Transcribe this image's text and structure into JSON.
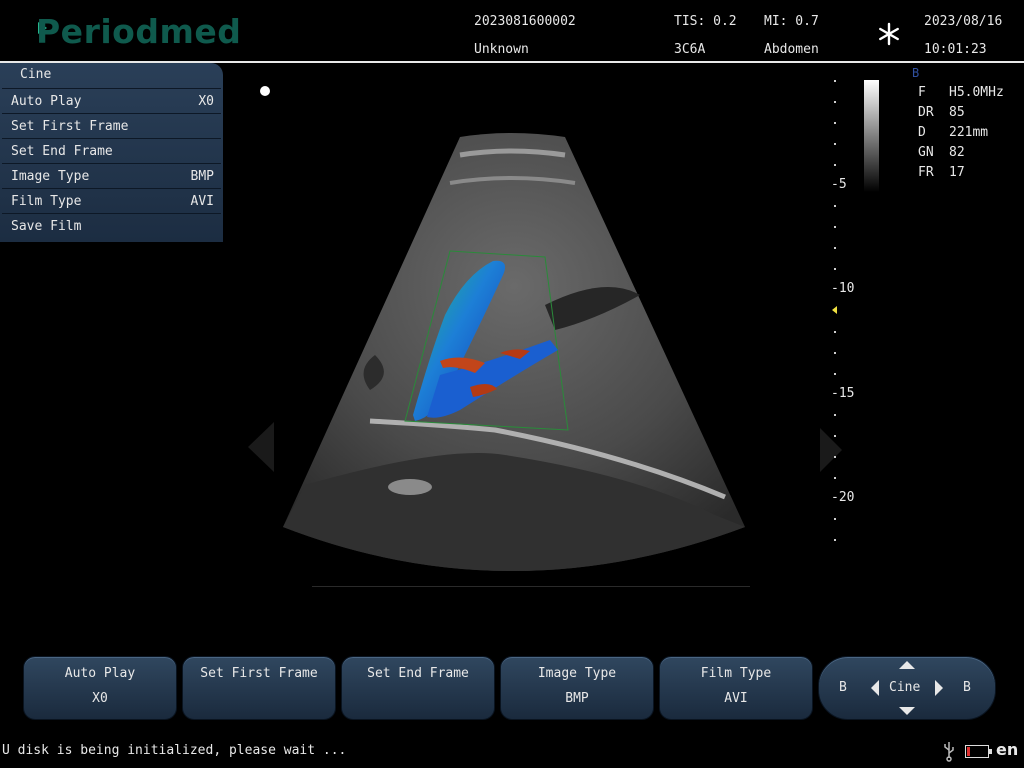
{
  "header": {
    "logo": "Periodmed",
    "patient_id": "2023081600002",
    "patient_name": "Unknown",
    "tis": "TIS: 0.2",
    "probe": "3C6A",
    "mi": "MI: 0.7",
    "exam": "Abdomen",
    "date": "2023/08/16",
    "time": "10:01:23"
  },
  "cine_menu": {
    "title": "Cine",
    "items": [
      {
        "label": "Auto Play",
        "value": "X0"
      },
      {
        "label": "Set First Frame",
        "value": ""
      },
      {
        "label": "Set End Frame",
        "value": ""
      },
      {
        "label": "Image Type",
        "value": "BMP"
      },
      {
        "label": "Film Type",
        "value": "AVI"
      },
      {
        "label": "Save Film",
        "value": ""
      }
    ]
  },
  "params": {
    "mode": "B",
    "rows": [
      {
        "key": "F",
        "value": "H5.0MHz"
      },
      {
        "key": "DR",
        "value": "85"
      },
      {
        "key": "D",
        "value": "221mm"
      },
      {
        "key": "GN",
        "value": "82"
      },
      {
        "key": "FR",
        "value": "17"
      }
    ]
  },
  "depth_scale": {
    "labels": [
      "-5",
      "-10",
      "-15",
      "-20"
    ]
  },
  "buttons": [
    {
      "line1": "Auto Play",
      "line2": "X0"
    },
    {
      "line1": "Set First Frame",
      "line2": ""
    },
    {
      "line1": "Set End Frame",
      "line2": ""
    },
    {
      "line1": "Image Type",
      "line2": "BMP"
    },
    {
      "line1": "Film Type",
      "line2": "AVI"
    }
  ],
  "nav": {
    "left": "B",
    "center": "Cine",
    "right": "B"
  },
  "status": {
    "message": "U disk is being initialized, please wait ...",
    "lang": "en"
  }
}
